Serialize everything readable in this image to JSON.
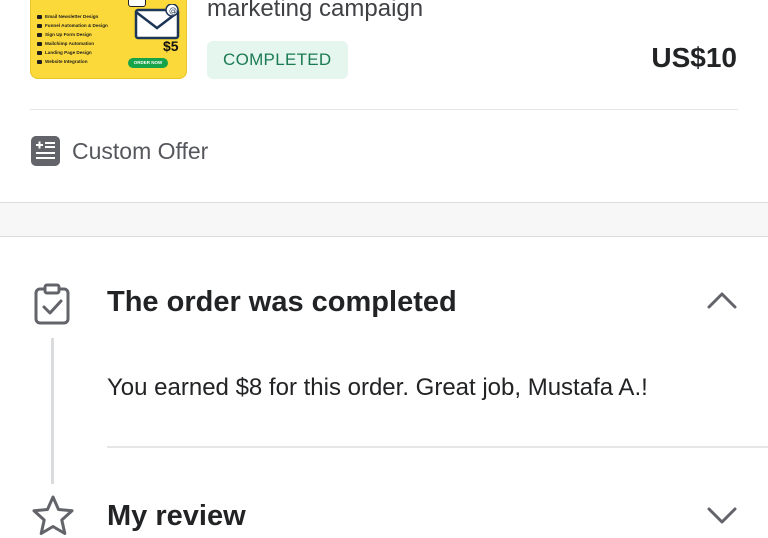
{
  "gig": {
    "title": "marketing campaign",
    "status": "COMPLETED",
    "price": "US$10",
    "thumbnail": {
      "features": [
        "Email Newsletter Design",
        "Funnel Automation & Design",
        "Sign Up Form Design",
        "Mailchimp Automation",
        "Landing Page Design",
        "Website Integration"
      ],
      "order_button": "ORDER NOW",
      "price_tag": "$5",
      "bg_color": "#fcd93a"
    }
  },
  "offer": {
    "label": "Custom Offer",
    "icon": "offer-list-icon"
  },
  "timeline": {
    "completed": {
      "title": "The order was completed",
      "body": "You earned $8 for this order. Great job, Mustafa A.!",
      "icon": "clipboard-check-icon"
    },
    "review": {
      "title": "My review",
      "icon": "star-icon"
    }
  },
  "colors": {
    "badge_bg": "#e5f6ef",
    "badge_text": "#1c7b53",
    "text": "#222325"
  }
}
